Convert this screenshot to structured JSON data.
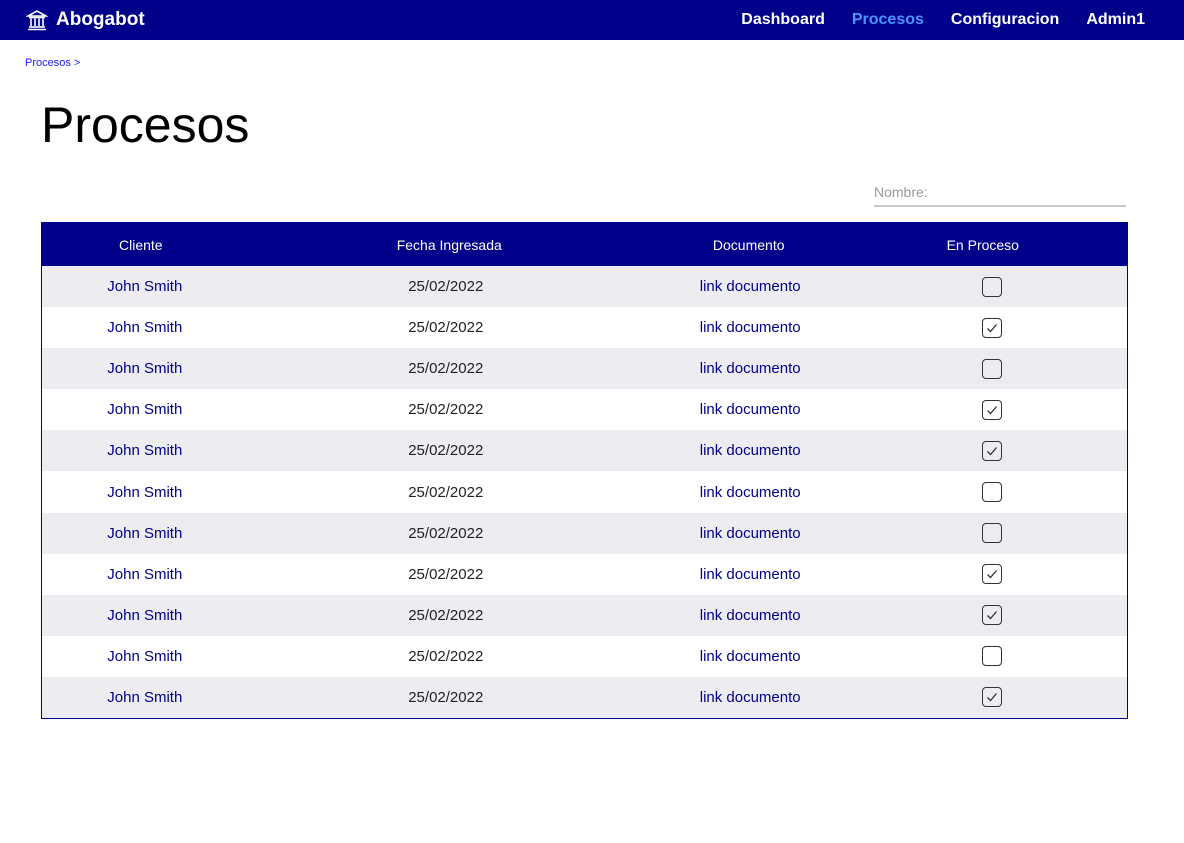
{
  "nav": {
    "brand": "Abogabot",
    "brand_icon": "courthouse-icon",
    "items": [
      "Dashboard",
      "Procesos",
      "Configuracion",
      "Admin1"
    ],
    "active": "Procesos"
  },
  "breadcrumb": "Procesos >",
  "page_title": "Procesos",
  "search": {
    "placeholder": "Nombre:",
    "value": ""
  },
  "table": {
    "headers": [
      "Cliente",
      "Fecha Ingresada",
      "Documento",
      "En Proceso"
    ],
    "rows": [
      {
        "cliente": "John Smith",
        "fecha": "25/02/2022",
        "documento": "link documento",
        "en_proceso": false
      },
      {
        "cliente": "John Smith",
        "fecha": "25/02/2022",
        "documento": "link documento",
        "en_proceso": true
      },
      {
        "cliente": "John Smith",
        "fecha": "25/02/2022",
        "documento": "link documento",
        "en_proceso": false
      },
      {
        "cliente": "John Smith",
        "fecha": "25/02/2022",
        "documento": "link documento",
        "en_proceso": true
      },
      {
        "cliente": "John Smith",
        "fecha": "25/02/2022",
        "documento": "link documento",
        "en_proceso": true
      },
      {
        "cliente": "John Smith",
        "fecha": "25/02/2022",
        "documento": "link documento",
        "en_proceso": false
      },
      {
        "cliente": "John Smith",
        "fecha": "25/02/2022",
        "documento": "link documento",
        "en_proceso": false
      },
      {
        "cliente": "John Smith",
        "fecha": "25/02/2022",
        "documento": "link documento",
        "en_proceso": true
      },
      {
        "cliente": "John Smith",
        "fecha": "25/02/2022",
        "documento": "link documento",
        "en_proceso": true
      },
      {
        "cliente": "John Smith",
        "fecha": "25/02/2022",
        "documento": "link documento",
        "en_proceso": false
      },
      {
        "cliente": "John Smith",
        "fecha": "25/02/2022",
        "documento": "link documento",
        "en_proceso": true
      }
    ]
  },
  "colors": {
    "navbar": "#00008b",
    "active_nav": "#4d94ff",
    "row_stripe": "#ececf1",
    "link": "#00008b"
  }
}
